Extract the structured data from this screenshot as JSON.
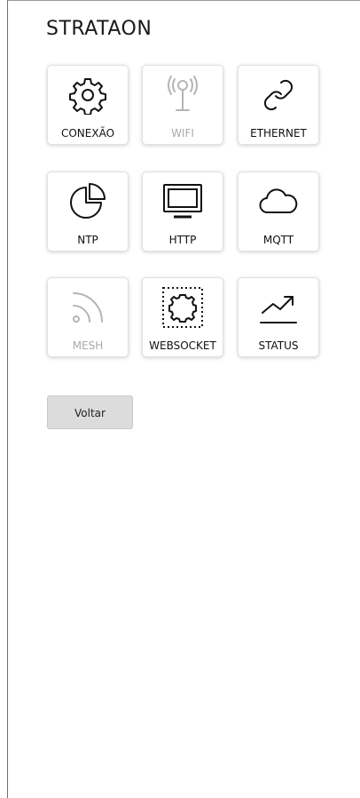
{
  "app": {
    "title": "STRATAON"
  },
  "tiles": [
    {
      "label": "CONEXÃO",
      "icon": "gear-icon",
      "enabled": true
    },
    {
      "label": "WIFI",
      "icon": "antenna-icon",
      "enabled": false
    },
    {
      "label": "ETHERNET",
      "icon": "link-icon",
      "enabled": true
    },
    {
      "label": "NTP",
      "icon": "pie-chart-icon",
      "enabled": true
    },
    {
      "label": "HTTP",
      "icon": "monitor-icon",
      "enabled": true
    },
    {
      "label": "MQTT",
      "icon": "cloud-icon",
      "enabled": true
    },
    {
      "label": "MESH",
      "icon": "rss-icon",
      "enabled": false
    },
    {
      "label": "WEBSOCKET",
      "icon": "websocket-gear-icon",
      "enabled": true
    },
    {
      "label": "STATUS",
      "icon": "trending-up-icon",
      "enabled": true
    }
  ],
  "actions": {
    "back_label": "Voltar"
  },
  "colors": {
    "enabled_icon": "#111111",
    "disabled_icon": "#b5b5b5",
    "button_bg": "#dcdcdc"
  }
}
